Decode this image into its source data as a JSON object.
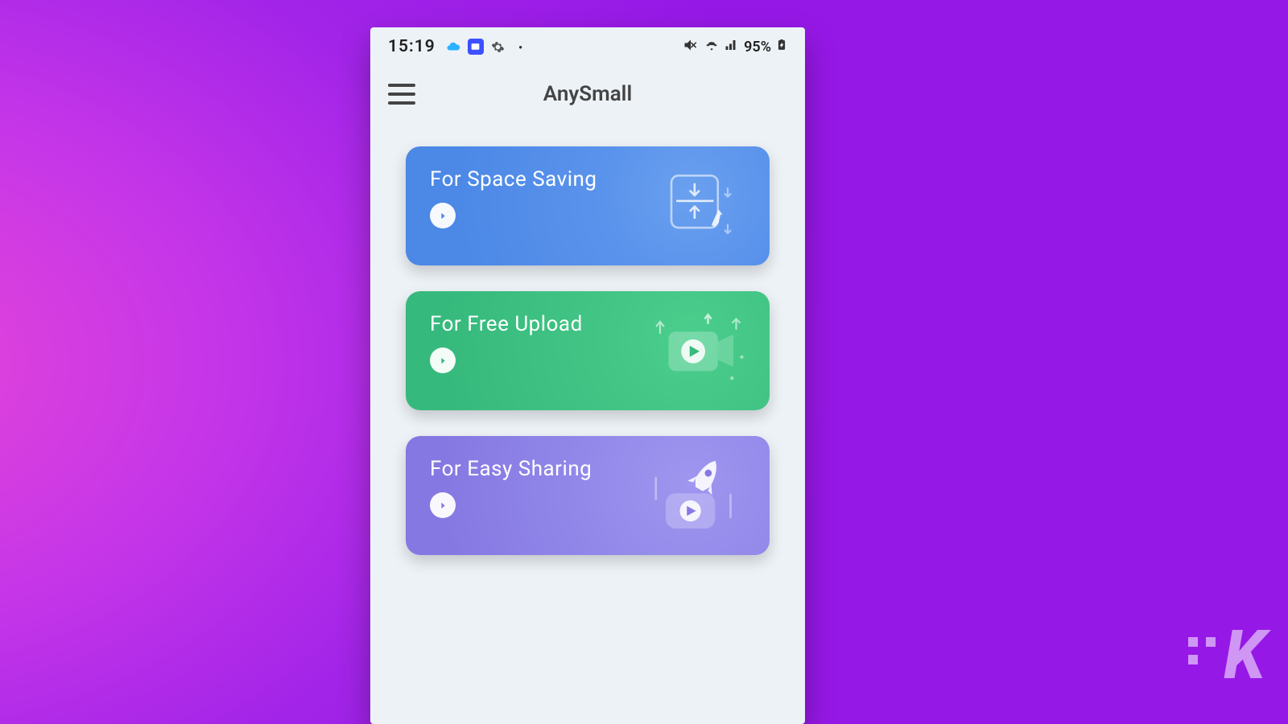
{
  "statusbar": {
    "time": "15:19",
    "battery_text": "95%"
  },
  "appbar": {
    "title": "AnySmall"
  },
  "cards": [
    {
      "title": "For Space Saving"
    },
    {
      "title": "For Free Upload"
    },
    {
      "title": "For Easy Sharing"
    }
  ],
  "watermark": {
    "letter": "K"
  }
}
